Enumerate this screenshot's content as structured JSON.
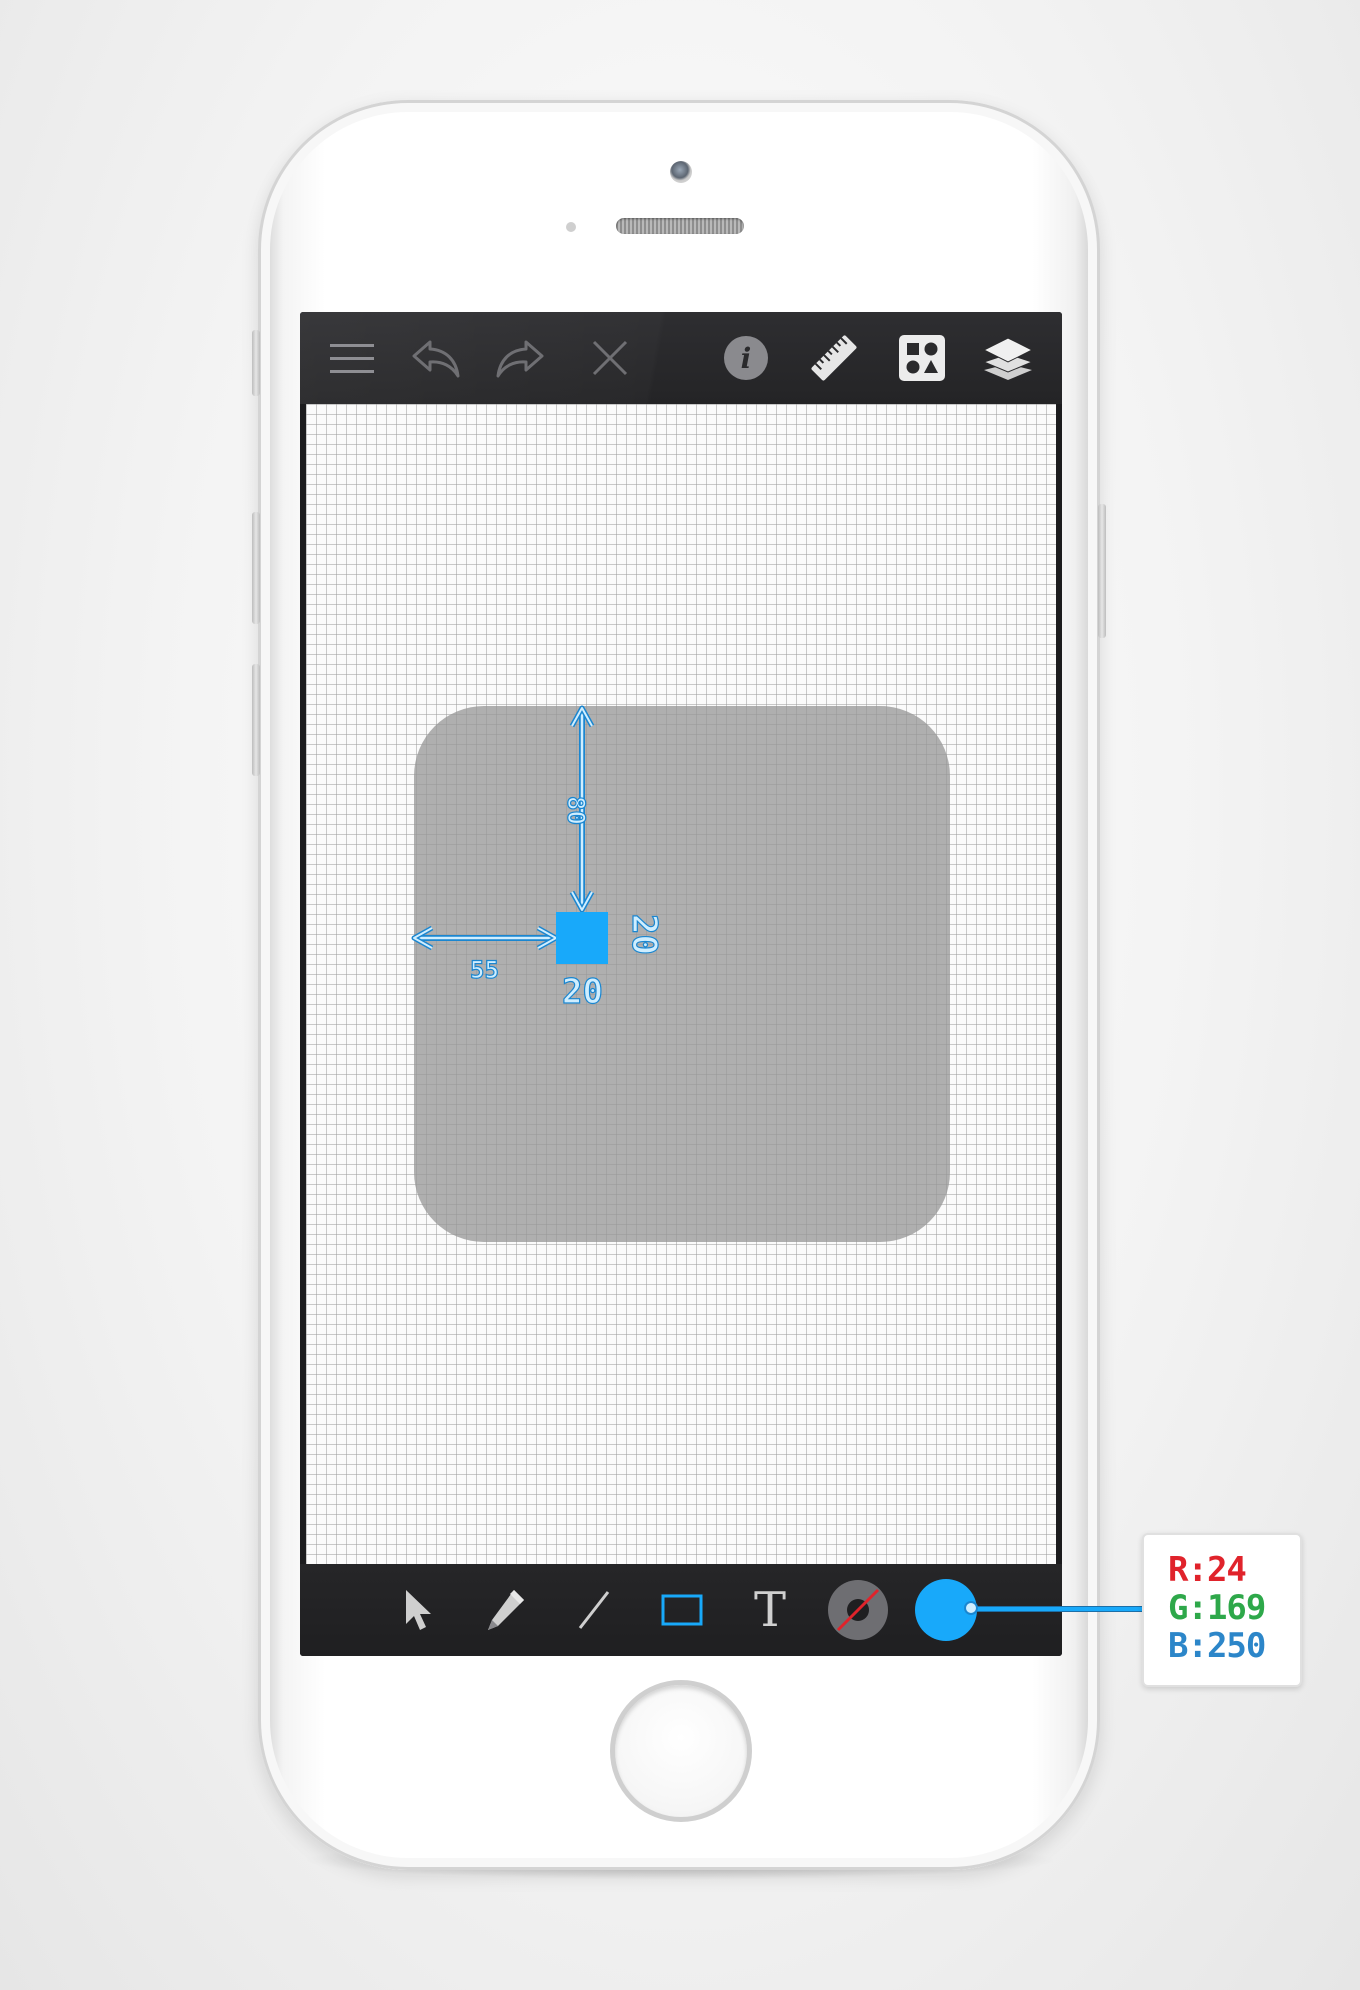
{
  "toolbar": {
    "items": [
      {
        "id": "menu",
        "icon": "hamburger-menu-icon"
      },
      {
        "id": "undo",
        "icon": "undo-icon"
      },
      {
        "id": "redo",
        "icon": "redo-icon"
      },
      {
        "id": "close",
        "icon": "close-icon"
      },
      {
        "id": "info",
        "icon": "info-icon",
        "glyph": "i"
      },
      {
        "id": "ruler",
        "icon": "ruler-icon"
      },
      {
        "id": "shapes",
        "icon": "shapes-icon"
      },
      {
        "id": "layers",
        "icon": "layers-icon"
      }
    ]
  },
  "tools": {
    "items": [
      {
        "id": "select",
        "icon": "pointer-arrow-icon"
      },
      {
        "id": "pencil",
        "icon": "pencil-icon"
      },
      {
        "id": "line",
        "icon": "line-icon"
      },
      {
        "id": "rectangle",
        "icon": "rectangle-icon",
        "active": true
      },
      {
        "id": "text",
        "icon": "text-tool-icon",
        "glyph": "T"
      },
      {
        "id": "stroke",
        "icon": "stroke-color-icon"
      },
      {
        "id": "fill",
        "icon": "fill-color-icon"
      }
    ],
    "active_color": "#18a9fa"
  },
  "canvas": {
    "rounded_shape_color": "#969696",
    "square_color": "#18a9fa",
    "dimensions": {
      "top_offset": "80",
      "left_offset": "55",
      "width": "20",
      "height": "20"
    }
  },
  "color_info": {
    "r": "R:24",
    "g": "G:169",
    "b": "B:250",
    "r_color": "#e0232b",
    "g_color": "#2ea84a",
    "b_color": "#2c86c9"
  }
}
